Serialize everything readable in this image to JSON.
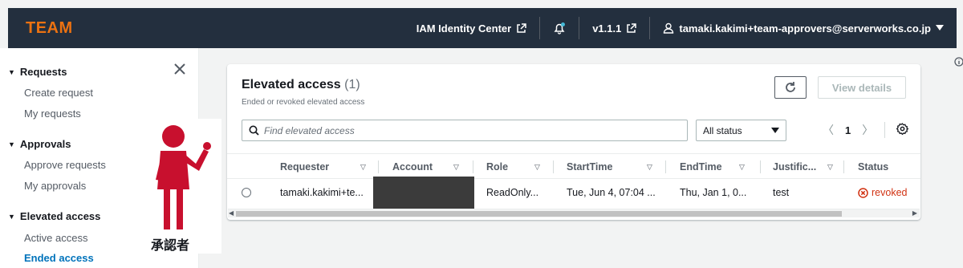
{
  "header": {
    "brand": "TEAM",
    "identity_center": "IAM Identity Center",
    "version": "v1.1.1",
    "user": "tamaki.kakimi+team-approvers@serverworks.co.jp",
    "colors": {
      "bg": "#232f3e",
      "brand": "#ec7211"
    }
  },
  "sidebar": {
    "groups": [
      {
        "label": "Requests",
        "items": [
          "Create request",
          "My requests"
        ]
      },
      {
        "label": "Approvals",
        "items": [
          "Approve requests",
          "My approvals"
        ]
      },
      {
        "label": "Elevated access",
        "items": [
          "Active access",
          "Ended access"
        ]
      }
    ],
    "active_item": "Ended access"
  },
  "overlay": {
    "label": "承認者",
    "figure_color": "#c8102e"
  },
  "panel": {
    "title": "Elevated access",
    "count": "(1)",
    "subtitle": "Ended or revoked elevated access",
    "view_details": "View details",
    "search_placeholder": "Find elevated access",
    "status_filter": "All status",
    "page": "1"
  },
  "table": {
    "columns": [
      "Requester",
      "Account",
      "Role",
      "StartTime",
      "EndTime",
      "Justific...",
      "Status"
    ],
    "rows": [
      {
        "requester": "tamaki.kakimi+te...",
        "account": "",
        "role": "ReadOnly...",
        "start": "Tue, Jun 4, 07:04 ...",
        "end": "Thu, Jan 1, 0...",
        "justification": "test",
        "status": "revoked"
      }
    ]
  }
}
